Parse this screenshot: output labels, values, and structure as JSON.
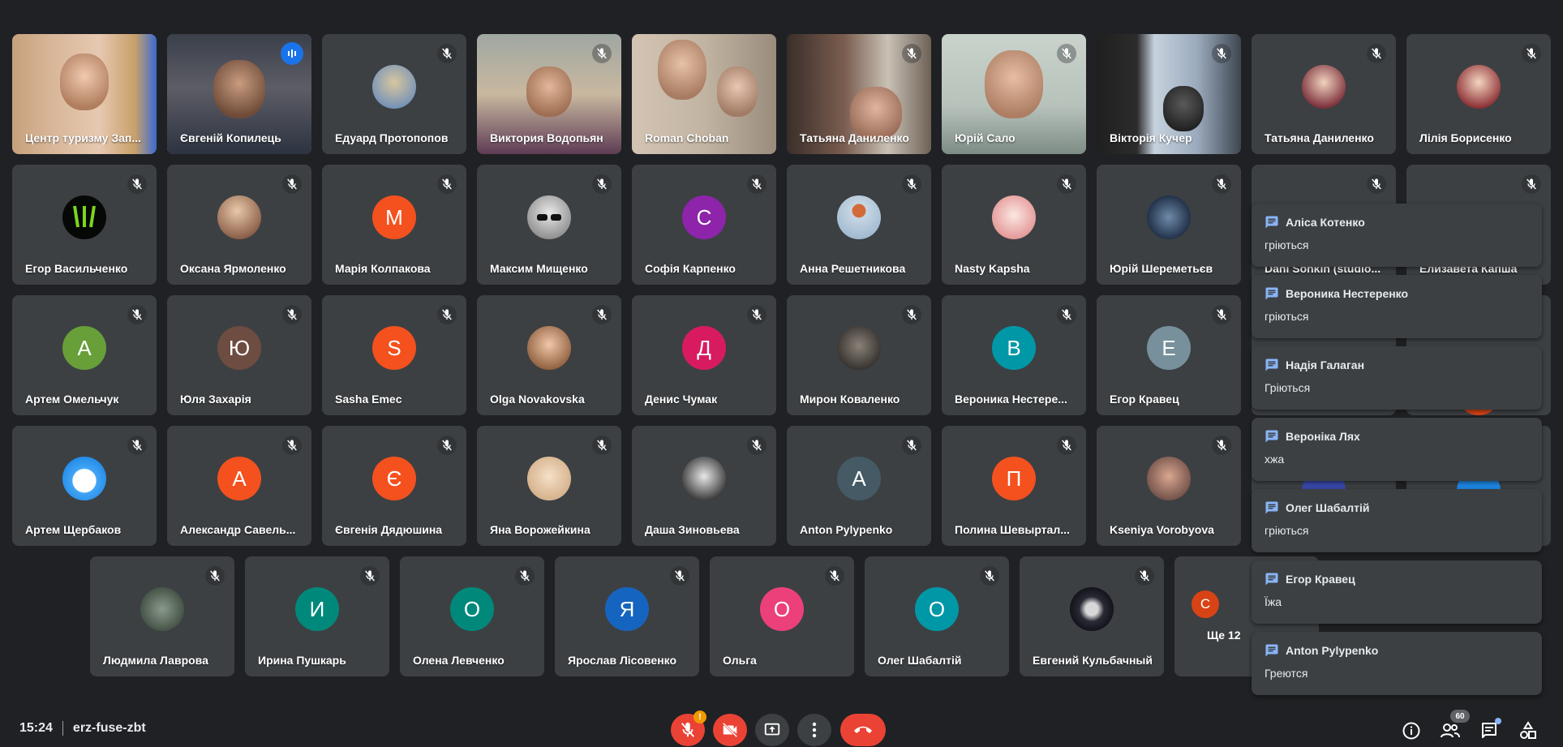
{
  "participants": [
    "Центр туризму Зап...",
    "Євгеній Копилець",
    "Едуард Протопопов",
    "Виктория Водопьян",
    "Roman Choban",
    "Татьяна Даниленко",
    "Юрій Сало",
    "Вікторія Кучер",
    "Татьяна Даниленко",
    "Лілія Борисенко",
    "Егор Васильченко",
    "Оксана Ярмоленко",
    "Марія Колпакова",
    "Максим Мищенко",
    "Софія Карпенко",
    "Анна Решетникова",
    "Nasty Kapsha",
    "Юрій Шереметьєв",
    "Dani Sonkin (studio...",
    "Елизавета Капша",
    "Артем Омельчук",
    "Юля Захарія",
    "Sasha Emec",
    "Olga Novakovska",
    "Денис Чумак",
    "Мирон Коваленко",
    "Вероника Нестере...",
    "Егор Кравец",
    "Артем Щербаков",
    "Александр Савель...",
    "Євгенія Дядюшина",
    "Яна Ворожейкина",
    "Даша Зиновьева",
    "Anton Pylypenko",
    "Полина Шевыртал...",
    "Kseniya Vorobyova",
    "Людмила Лаврова",
    "Ирина Пушкарь",
    "Олена Левченко",
    "Ярослав Лісовенко",
    "Ольга",
    "Олег Шабалтій",
    "Евгений Кульбачный",
    "Ще 12"
  ],
  "initials": {
    "mariia": "М",
    "sofia": "С",
    "artem": "А",
    "yulia": "Ю",
    "sasha": "S",
    "denys": "Д",
    "veronika": "В",
    "egor": "Е",
    "oleksandr": "А",
    "yevheniia": "Є",
    "anton": "А",
    "polina": "П",
    "iryna": "И",
    "olena": "О",
    "yaroslav": "Я",
    "olga": "О",
    "oleh": "О",
    "more": "С"
  },
  "chat": [
    {
      "name": "Аліса Котенко",
      "text": "гріються"
    },
    {
      "name": "Вероника Нестеренко",
      "text": "гріються"
    },
    {
      "name": "Надія Галаган",
      "text": "Гріються"
    },
    {
      "name": "Вероніка Лях",
      "text": "хжа"
    },
    {
      "name": "Олег Шабалтій",
      "text": "гріються"
    },
    {
      "name": "Егор Кравец",
      "text": "Їжа"
    },
    {
      "name": "Anton Pylypenko",
      "text": "Греются"
    }
  ],
  "meeting": {
    "time": "15:24",
    "code": "erz-fuse-zbt"
  },
  "badges": {
    "mic_alert": "!",
    "people_count": "60"
  },
  "colors": {
    "background": "#202124",
    "tile": "#3c4043",
    "end_call": "#ea4335",
    "green": "#689f38",
    "orange": "#f4511e",
    "purple": "#8e24aa",
    "pink": "#d81b60",
    "brown": "#6d4c41",
    "teal": "#0097a7",
    "blue_grey": "#78909c",
    "slate": "#455a64",
    "dark_teal": "#00897b",
    "blue": "#1565c0",
    "hot_pink": "#ec407a",
    "accent": "#8ab4f8"
  },
  "icons": [
    "mic-off-icon",
    "speaking-icon",
    "chat-icon",
    "info-icon",
    "people-icon",
    "chat-bubble-icon",
    "activities-icon",
    "camera-off-icon",
    "present-icon",
    "more-icon",
    "end-call-icon"
  ]
}
